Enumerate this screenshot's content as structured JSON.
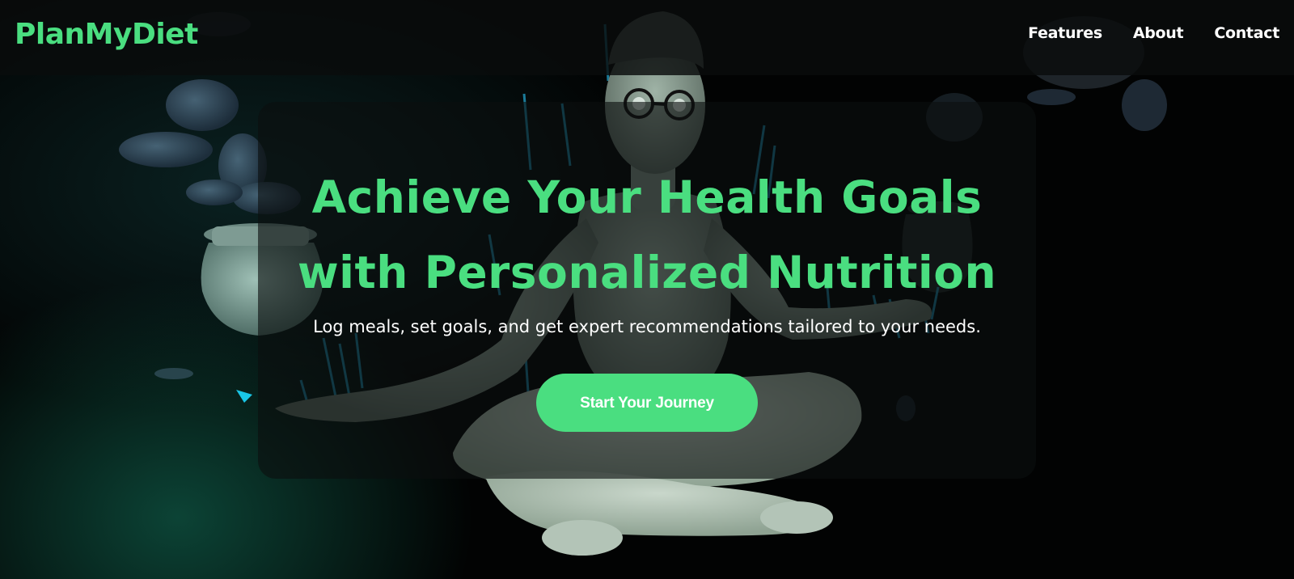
{
  "brand": {
    "name": "PlanMyDiet",
    "color": "#4ade80"
  },
  "nav": {
    "links": [
      {
        "label": "Features"
      },
      {
        "label": "About"
      },
      {
        "label": "Contact"
      }
    ]
  },
  "hero": {
    "title_line1": "Achieve Your Health Goals",
    "title_line2": "with Personalized Nutrition",
    "subtitle": "Log meals, set goals, and get expert recommendations tailored to your needs.",
    "cta_label": "Start Your Journey"
  },
  "colors": {
    "accent": "#4ade80",
    "background": "#020303",
    "text": "#ffffff"
  },
  "background_image": {
    "icon": "meditating-figure-illustration"
  }
}
